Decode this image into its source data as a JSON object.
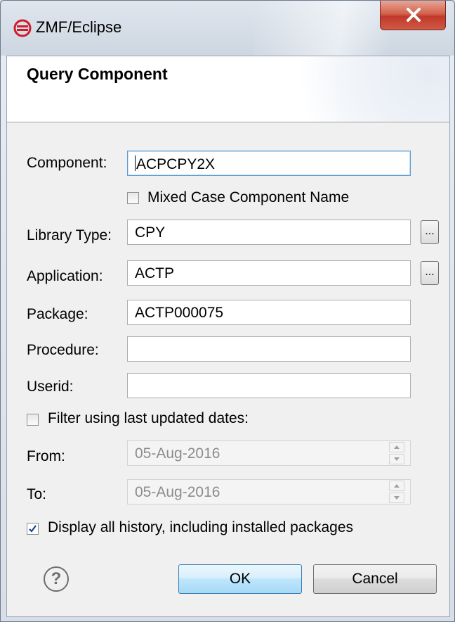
{
  "window": {
    "title": "ZMF/Eclipse"
  },
  "banner": {
    "title": "Query Component"
  },
  "form": {
    "component_label": "Component:",
    "component_value": "ACPCPY2X",
    "mixed_case_label": "Mixed Case Component Name",
    "mixed_case_checked": false,
    "library_type_label": "Library Type:",
    "library_type_value": "CPY",
    "application_label": "Application:",
    "application_value": "ACTP",
    "package_label": "Package:",
    "package_value": "ACTP000075",
    "procedure_label": "Procedure:",
    "procedure_value": "",
    "userid_label": "Userid:",
    "userid_value": "",
    "filter_dates_label": "Filter using last updated dates:",
    "filter_dates_checked": false,
    "from_label": "From:",
    "from_value": "05-Aug-2016",
    "to_label": "To:",
    "to_value": "05-Aug-2016",
    "display_history_label": "Display all history, including installed packages",
    "display_history_checked": true,
    "browse_label": "..."
  },
  "buttons": {
    "help_label": "?",
    "ok_label": "OK",
    "cancel_label": "Cancel"
  },
  "icons": {
    "app": "serena-logo-icon",
    "close": "close-icon",
    "help": "help-icon",
    "check": "check-icon",
    "spin_up": "spin-up-icon",
    "spin_down": "spin-down-icon"
  },
  "colors": {
    "close_button": "#c0392b",
    "default_button_border": "#3c7fb1",
    "focus_border": "#5b9bd5",
    "app_icon": "#d11a2a"
  }
}
